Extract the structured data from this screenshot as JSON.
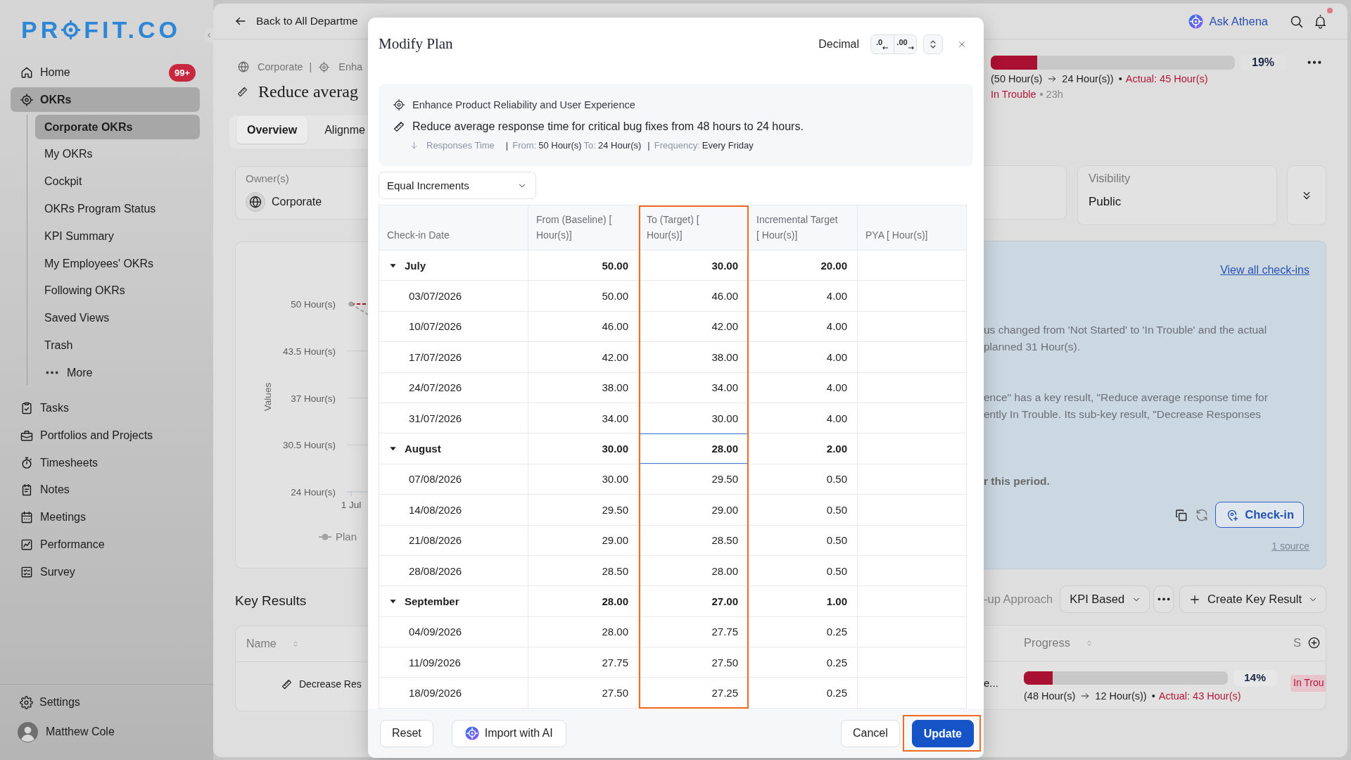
{
  "sidebar": {
    "logo": {
      "left": "PR",
      "right": "FIT.CO"
    },
    "items": [
      {
        "label": "Home",
        "selected": false,
        "badge": "99+"
      },
      {
        "label": "OKRs",
        "selected": true,
        "children": [
          {
            "label": "Corporate OKRs",
            "selected": true
          },
          {
            "label": "My OKRs",
            "selected": false
          },
          {
            "label": "Cockpit",
            "selected": false
          },
          {
            "label": "OKRs Program Status",
            "selected": false
          },
          {
            "label": "KPI Summary",
            "selected": false
          },
          {
            "label": "My Employees' OKRs",
            "selected": false
          },
          {
            "label": "Following OKRs",
            "selected": false
          },
          {
            "label": "Saved Views",
            "selected": false
          },
          {
            "label": "Trash",
            "selected": false
          }
        ],
        "more_label": "More"
      },
      {
        "label": "Tasks",
        "selected": false
      },
      {
        "label": "Portfolios and Projects",
        "selected": false
      },
      {
        "label": "Timesheets",
        "selected": false
      },
      {
        "label": "Notes",
        "selected": false
      },
      {
        "label": "Meetings",
        "selected": false
      },
      {
        "label": "Performance",
        "selected": false
      },
      {
        "label": "Survey",
        "selected": false
      }
    ],
    "settings": "Settings",
    "user": "Matthew Cole"
  },
  "header": {
    "back_link": "Back to All Departme",
    "assistant": "Ask Athena",
    "unread": true
  },
  "page": {
    "breadcrumb": [
      "Corporate",
      "Enha"
    ],
    "breadcrumb_separator": "|",
    "title": "Reduce averag",
    "tabs": [
      {
        "label": "Overview",
        "selected": true
      },
      {
        "label": "Alignme",
        "selected": false
      }
    ],
    "owner": {
      "label": "Owner(s)",
      "value": "Corporate"
    },
    "progress": {
      "level": 0.19,
      "percent": "19%",
      "from": "(50 Hour(s)",
      "to": "24 Hour(s))",
      "bullet": "•",
      "actual": "Actual: 45 Hour(s)",
      "status": "In Trouble",
      "age": "• 23h"
    },
    "visibility": {
      "label": "Visibility",
      "value": "Public"
    },
    "chart": {
      "chart_data": {
        "type": "line",
        "ylabel": "Values",
        "categories": [
          "1 Jul"
        ],
        "ylim": [
          24,
          50
        ],
        "yticks": [
          {
            "value": 50,
            "label": "50 Hour(s)"
          },
          {
            "value": 43.5,
            "label": "43.5 Hour(s)"
          },
          {
            "value": 37,
            "label": "37 Hour(s)"
          },
          {
            "value": 30.5,
            "label": "30.5 Hour(s)"
          },
          {
            "value": 24,
            "label": "24 Hour(s)"
          }
        ],
        "series": [
          {
            "name": "Plan",
            "color": "#a3a3a3",
            "marker": "circle",
            "values": [
              50
            ]
          }
        ]
      }
    },
    "summary": {
      "link": "View all check-ins",
      "paragraphs": [
        {
          "bold": false,
          "lines": [
            "us changed from 'Not Started' to 'In Trouble' and the actual",
            "planned 31 Hour(s)."
          ]
        },
        {
          "bold": false,
          "lines": [
            "ence\" has a key result, \"Reduce average response time for",
            "ently In Trouble. Its sub-key result, \"Decrease Responses"
          ]
        },
        {
          "bold": true,
          "lines": [
            "r this period."
          ]
        }
      ],
      "action": "Check-in",
      "source": "1 source"
    },
    "key_results": {
      "title": "Key Results",
      "approach_label": "-up Approach",
      "approach": "KPI Based",
      "create_button": "Create Key Result",
      "columns": [
        {
          "label": "Name"
        },
        {
          "label": "Progress"
        },
        {
          "label": "S"
        }
      ],
      "rows": [
        {
          "name": "Decrease Res",
          "column_2": "e...",
          "level": 0.14,
          "percent": "14%",
          "from": "(48 Hour(s)",
          "to": "12 Hour(s))",
          "bullet": "•",
          "actual": "Actual: 43 Hour(s)",
          "status": "In Trou"
        }
      ]
    }
  },
  "modal": {
    "title": "Modify Plan",
    "format_label": "Decimal",
    "decimal_buttons": [
      ".0",
      ".00"
    ],
    "objective": "Enhance Product Reliability and User Experience",
    "key_result": "Reduce average response time for critical bug fixes from 48 hours to 24 hours.",
    "meta": [
      {
        "kind": "metric",
        "value": "Responses Time"
      },
      {
        "kind": "separator",
        "value": "|"
      },
      {
        "kind": "field",
        "label": "From:",
        "value": "50 Hour(s)"
      },
      {
        "kind": "field",
        "label": "To:",
        "value": "24 Hour(s)"
      },
      {
        "kind": "separator",
        "value": "|"
      },
      {
        "kind": "field",
        "label": "Frequency:",
        "value": "Every Friday"
      }
    ],
    "distribution": "Equal Increments",
    "columns": [
      {
        "label": "Check-in Date",
        "highlighted": false
      },
      {
        "label": "From (Baseline) [ Hour(s)]",
        "highlighted": false
      },
      {
        "label": "To (Target) [ Hour(s)]",
        "highlighted": true
      },
      {
        "label": "Incremental Target [ Hour(s)]",
        "highlighted": false
      },
      {
        "label": "PYA [ Hour(s)]",
        "highlighted": false
      }
    ],
    "rows": [
      {
        "label": "July",
        "expanded": true,
        "from": "50.00",
        "to": "30.00",
        "increment": "20.00",
        "editing": false,
        "children": [
          {
            "label": "03/07/2026",
            "from": "50.00",
            "to": "46.00",
            "increment": "4.00",
            "editing": false
          },
          {
            "label": "10/07/2026",
            "from": "46.00",
            "to": "42.00",
            "increment": "4.00",
            "editing": false
          },
          {
            "label": "17/07/2026",
            "from": "42.00",
            "to": "38.00",
            "increment": "4.00",
            "editing": false
          },
          {
            "label": "24/07/2026",
            "from": "38.00",
            "to": "34.00",
            "increment": "4.00",
            "editing": false
          },
          {
            "label": "31/07/2026",
            "from": "34.00",
            "to": "30.00",
            "increment": "4.00",
            "editing": false
          }
        ]
      },
      {
        "label": "August",
        "expanded": true,
        "from": "30.00",
        "to": "28.00",
        "increment": "2.00",
        "editing": true,
        "children": [
          {
            "label": "07/08/2026",
            "from": "30.00",
            "to": "29.50",
            "increment": "0.50",
            "editing": false
          },
          {
            "label": "14/08/2026",
            "from": "29.50",
            "to": "29.00",
            "increment": "0.50",
            "editing": false
          },
          {
            "label": "21/08/2026",
            "from": "29.00",
            "to": "28.50",
            "increment": "0.50",
            "editing": false
          },
          {
            "label": "28/08/2026",
            "from": "28.50",
            "to": "28.00",
            "increment": "0.50",
            "editing": false
          }
        ]
      },
      {
        "label": "September",
        "expanded": true,
        "from": "28.00",
        "to": "27.00",
        "increment": "1.00",
        "editing": false,
        "children": [
          {
            "label": "04/09/2026",
            "from": "28.00",
            "to": "27.75",
            "increment": "0.25",
            "editing": false
          },
          {
            "label": "11/09/2026",
            "from": "27.75",
            "to": "27.50",
            "increment": "0.25",
            "editing": false
          },
          {
            "label": "18/09/2026",
            "from": "27.50",
            "to": "27.25",
            "increment": "0.25",
            "editing": false
          }
        ]
      }
    ],
    "footer_left": [
      {
        "label": "Reset",
        "kind": "plain",
        "highlighted": false
      },
      {
        "label": "Import with AI",
        "kind": "ai",
        "highlighted": false
      }
    ],
    "footer_right": [
      {
        "label": "Cancel",
        "kind": "plain",
        "highlighted": false
      },
      {
        "label": "Update",
        "kind": "primary",
        "highlighted": true
      }
    ]
  }
}
